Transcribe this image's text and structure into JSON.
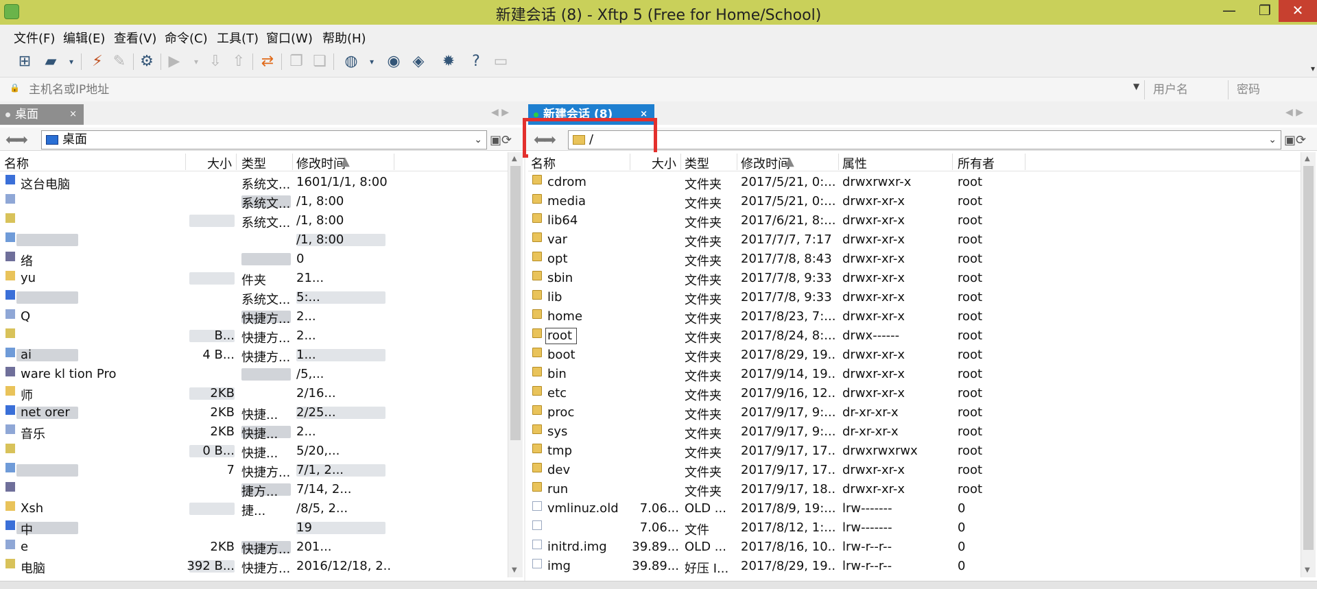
{
  "window": {
    "title": "新建会话 (8)    - Xftp 5 (Free for Home/School)",
    "minimize": "—",
    "maximize": "❐",
    "close": "✕"
  },
  "menu": [
    "文件(F)",
    "编辑(E)",
    "查看(V)",
    "命令(C)",
    "工具(T)",
    "窗口(W)",
    "帮助(H)"
  ],
  "address": {
    "host_placeholder": "主机名或IP地址",
    "user_placeholder": "用户名",
    "pass_placeholder": "密码"
  },
  "tabs": {
    "local": "桌面",
    "remote": "新建会话 (8)",
    "close": "×"
  },
  "local": {
    "path": "桌面",
    "columns": [
      "名称",
      "大小",
      "类型",
      "修改时间"
    ],
    "rows": [
      {
        "name": "这台电脑",
        "size": "",
        "type": "系统文...",
        "modified": "1601/1/1, 8:00"
      },
      {
        "name": "",
        "size": "",
        "type": "系统文...",
        "modified": "/1, 8:00"
      },
      {
        "name": "",
        "size": "",
        "type": "系统文...",
        "modified": "/1, 8:00"
      },
      {
        "name": "",
        "size": "",
        "type": "",
        "modified": "/1, 8:00"
      },
      {
        "name": "络",
        "size": "",
        "type": "",
        "modified": "0"
      },
      {
        "name": "yu",
        "size": "",
        "type": "件夹",
        "modified": "21..."
      },
      {
        "name": "",
        "size": "",
        "type": "系统文...",
        "modified": "5:..."
      },
      {
        "name": "Q",
        "size": "",
        "type": "快捷方...",
        "modified": "2..."
      },
      {
        "name": "",
        "size": "B...",
        "type": "快捷方...",
        "modified": "2..."
      },
      {
        "name": "ai",
        "size": "4 B...",
        "type": "快捷方...",
        "modified": "1..."
      },
      {
        "name": "ware   kl   tion Pro",
        "size": "",
        "type": "",
        "modified": "/5,..."
      },
      {
        "name": "师",
        "size": "2KB",
        "type": "",
        "modified": "2/16..."
      },
      {
        "name": "net   orer",
        "size": "2KB",
        "type": "快捷...",
        "modified": "2/25..."
      },
      {
        "name": "音乐",
        "size": "2KB",
        "type": "快捷...",
        "modified": "2..."
      },
      {
        "name": "",
        "size": "0 B...",
        "type": "快捷...",
        "modified": "5/20,..."
      },
      {
        "name": "",
        "size": "7",
        "type": "快捷方...",
        "modified": "7/1, 2..."
      },
      {
        "name": "",
        "size": "",
        "type": "捷方...",
        "modified": "7/14, 2..."
      },
      {
        "name": "Xsh",
        "size": "",
        "type": "捷...",
        "modified": "/8/5, 2..."
      },
      {
        "name": "中",
        "size": "",
        "type": "",
        "modified": "19"
      },
      {
        "name": "e",
        "size": "2KB",
        "type": "快捷方...",
        "modified": "201..."
      },
      {
        "name": "电脑",
        "size": "392 B...",
        "type": "快捷方...",
        "modified": "2016/12/18, 2..."
      }
    ]
  },
  "remote": {
    "path": "/",
    "columns": [
      "名称",
      "大小",
      "类型",
      "修改时间",
      "属性",
      "所有者"
    ],
    "rows": [
      {
        "name": "cdrom",
        "size": "",
        "type": "文件夹",
        "modified": "2017/5/21, 0:...",
        "attr": "drwxrwxr-x",
        "owner": "root"
      },
      {
        "name": "media",
        "size": "",
        "type": "文件夹",
        "modified": "2017/5/21, 0:...",
        "attr": "drwxr-xr-x",
        "owner": "root"
      },
      {
        "name": "lib64",
        "size": "",
        "type": "文件夹",
        "modified": "2017/6/21, 8:...",
        "attr": "drwxr-xr-x",
        "owner": "root"
      },
      {
        "name": "var",
        "size": "",
        "type": "文件夹",
        "modified": "2017/7/7, 7:17",
        "attr": "drwxr-xr-x",
        "owner": "root"
      },
      {
        "name": "opt",
        "size": "",
        "type": "文件夹",
        "modified": "2017/7/8, 8:43",
        "attr": "drwxr-xr-x",
        "owner": "root"
      },
      {
        "name": "sbin",
        "size": "",
        "type": "文件夹",
        "modified": "2017/7/8, 9:33",
        "attr": "drwxr-xr-x",
        "owner": "root"
      },
      {
        "name": "lib",
        "size": "",
        "type": "文件夹",
        "modified": "2017/7/8, 9:33",
        "attr": "drwxr-xr-x",
        "owner": "root"
      },
      {
        "name": "home",
        "size": "",
        "type": "文件夹",
        "modified": "2017/8/23, 7:...",
        "attr": "drwxr-xr-x",
        "owner": "root"
      },
      {
        "name": "root",
        "size": "",
        "type": "文件夹",
        "modified": "2017/8/24, 8:...",
        "attr": "drwx------",
        "owner": "root"
      },
      {
        "name": "boot",
        "size": "",
        "type": "文件夹",
        "modified": "2017/8/29, 19...",
        "attr": "drwxr-xr-x",
        "owner": "root"
      },
      {
        "name": "bin",
        "size": "",
        "type": "文件夹",
        "modified": "2017/9/14, 19...",
        "attr": "drwxr-xr-x",
        "owner": "root"
      },
      {
        "name": "etc",
        "size": "",
        "type": "文件夹",
        "modified": "2017/9/16, 12...",
        "attr": "drwxr-xr-x",
        "owner": "root"
      },
      {
        "name": "proc",
        "size": "",
        "type": "文件夹",
        "modified": "2017/9/17, 9:...",
        "attr": "dr-xr-xr-x",
        "owner": "root"
      },
      {
        "name": "sys",
        "size": "",
        "type": "文件夹",
        "modified": "2017/9/17, 9:...",
        "attr": "dr-xr-xr-x",
        "owner": "root"
      },
      {
        "name": "tmp",
        "size": "",
        "type": "文件夹",
        "modified": "2017/9/17, 17...",
        "attr": "drwxrwxrwx",
        "owner": "root"
      },
      {
        "name": "dev",
        "size": "",
        "type": "文件夹",
        "modified": "2017/9/17, 17...",
        "attr": "drwxr-xr-x",
        "owner": "root"
      },
      {
        "name": "run",
        "size": "",
        "type": "文件夹",
        "modified": "2017/9/17, 18...",
        "attr": "drwxr-xr-x",
        "owner": "root"
      },
      {
        "name": "vmlinuz.old",
        "size": "7.06...",
        "type": "OLD ...",
        "modified": "2017/8/9, 19:...",
        "attr": "lrw-------",
        "owner": "0"
      },
      {
        "name": "",
        "size": "7.06...",
        "type": "文件",
        "modified": "2017/8/12, 1:...",
        "attr": "lrw-------",
        "owner": "0"
      },
      {
        "name": "initrd.img",
        "size": "39.89...",
        "type": "OLD ...",
        "modified": "2017/8/16, 10...",
        "attr": "lrw-r--r--",
        "owner": "0"
      },
      {
        "name": "img",
        "size": "39.89...",
        "type": "好压 I...",
        "modified": "2017/8/29, 19...",
        "attr": "lrw-r--r--",
        "owner": "0"
      }
    ]
  }
}
